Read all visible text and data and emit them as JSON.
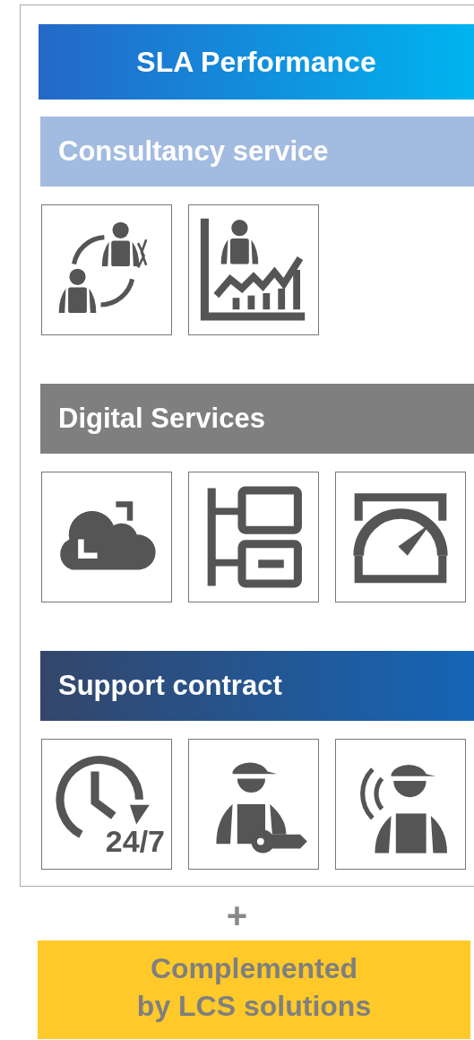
{
  "title": "SLA Performance",
  "sections": [
    {
      "title": "Consultancy service",
      "kind": "light",
      "icons": [
        {
          "kind": "people-cycle"
        },
        {
          "kind": "person-chart"
        }
      ]
    },
    {
      "title": "Digital Services",
      "kind": "gray",
      "icons": [
        {
          "kind": "cloud"
        },
        {
          "kind": "tree"
        },
        {
          "kind": "gauge"
        }
      ]
    },
    {
      "title": "Support contract",
      "kind": "dark",
      "icons": [
        {
          "kind": "clock",
          "label": "24/7"
        },
        {
          "kind": "worker-key"
        },
        {
          "kind": "worker-signal"
        }
      ]
    }
  ],
  "separator": "+",
  "footer": [
    "Complemented",
    "by LCS solutions"
  ]
}
